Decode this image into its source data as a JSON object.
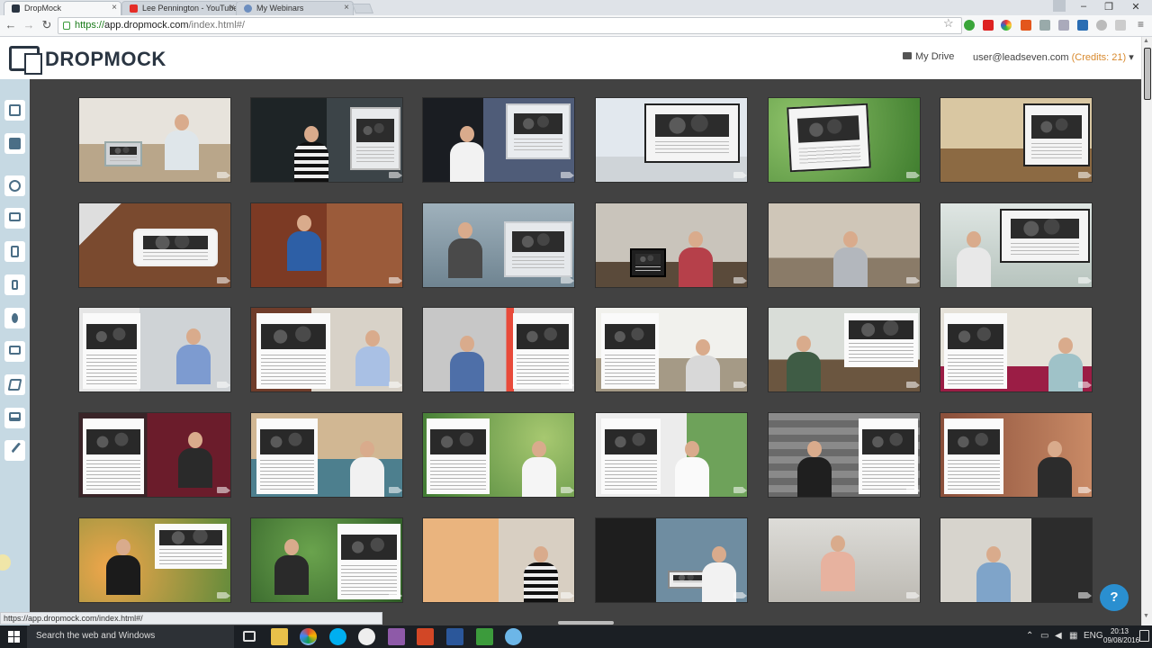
{
  "browser": {
    "tabs": [
      {
        "title": "DropMock",
        "active": true,
        "favicon_color": "#2a3542"
      },
      {
        "title": "Lee Pennington - YouTube",
        "active": false,
        "favicon_color": "#e52d27"
      },
      {
        "title": "My Webinars",
        "active": false,
        "favicon_color": "#6c8ebf"
      }
    ],
    "url": {
      "scheme": "https://",
      "host": "app.dropmock.com",
      "path": "/index.html#/"
    },
    "status_url": "https://app.dropmock.com/index.html#/"
  },
  "app": {
    "logo_text": "DROPMOCK",
    "my_drive_label": "My Drive",
    "account_email": "user@leadseven.com",
    "credits_label": "(Credits: 21)",
    "caret": "▾",
    "help_label": "?"
  },
  "sidebar": {
    "tools": [
      "image-tool-icon",
      "video-tool-icon",
      "globe-tool-icon",
      "monitor-tool-icon",
      "tablet-tool-icon",
      "phone-tool-icon",
      "person-tool-icon",
      "desktop-tool-icon",
      "book-tool-icon",
      "laptop-tool-icon",
      "brush-tool-icon"
    ]
  },
  "colors": {
    "gallery_bg": "#424242",
    "sidebar_bg": "#c6d9e3",
    "accent": "#d8892d",
    "help_button": "#2a8fd0"
  },
  "taskbar": {
    "search_placeholder": "Search the web and Windows",
    "language": "ENG",
    "time": "20:13",
    "date": "09/08/2016"
  }
}
